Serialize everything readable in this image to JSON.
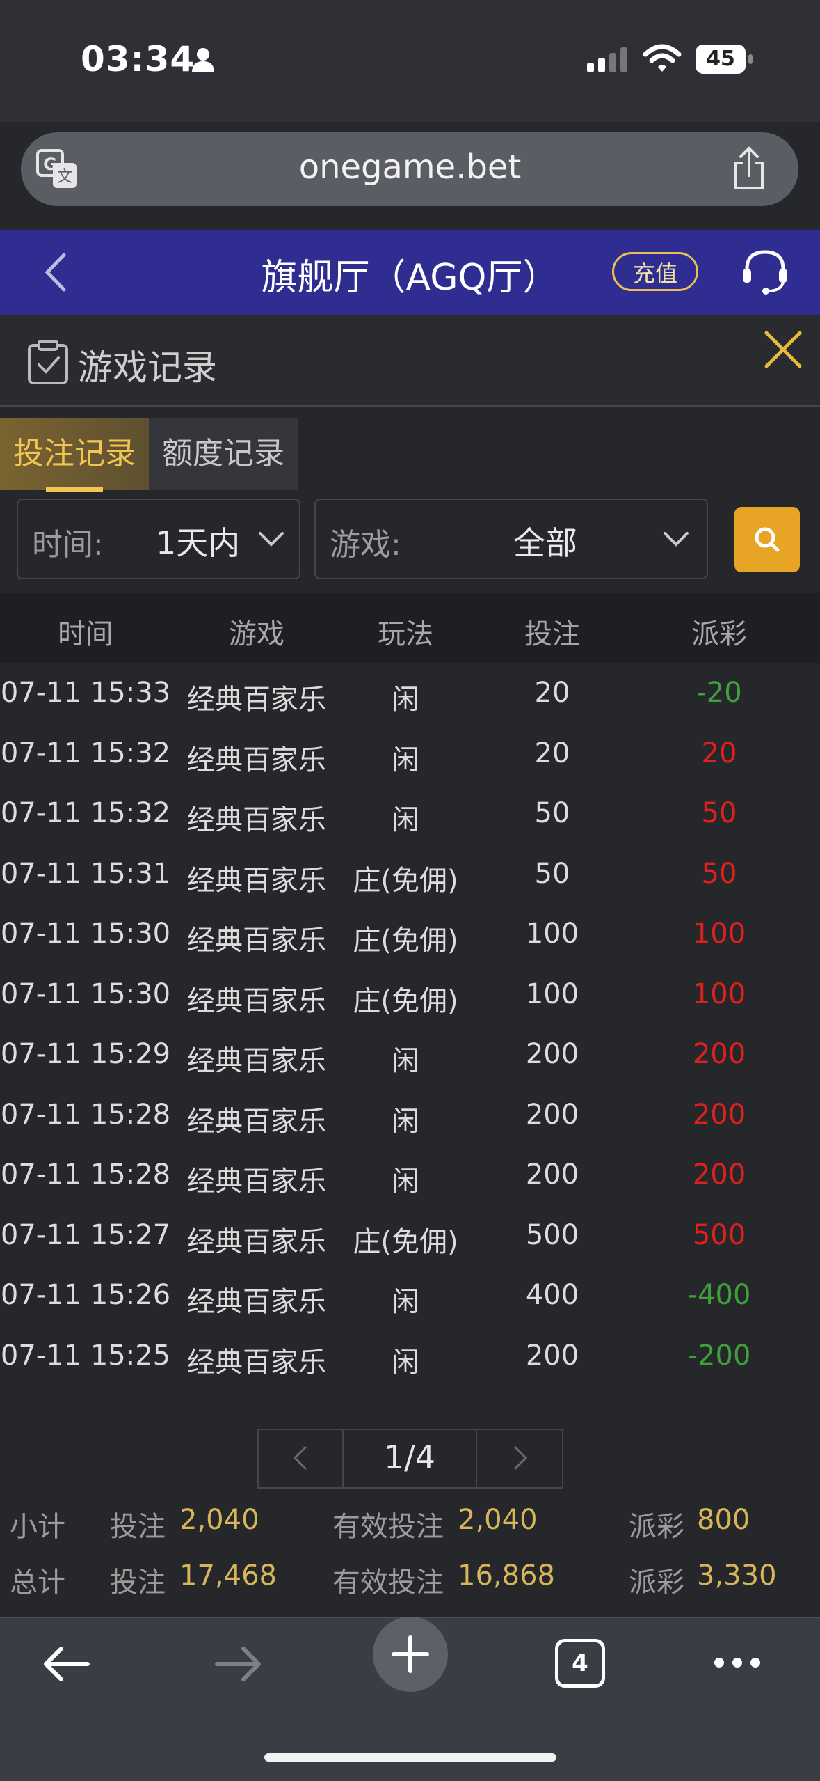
{
  "status": {
    "time": "03:34",
    "battery": "45"
  },
  "browser": {
    "url": "onegame.bet",
    "tab_count": "4"
  },
  "header": {
    "title": "旗舰厅（AGQ厅）",
    "recharge_label": "充值"
  },
  "section": {
    "title": "游戏记录"
  },
  "tabs": [
    {
      "label": "投注记录",
      "active": true
    },
    {
      "label": "额度记录",
      "active": false
    }
  ],
  "filters": {
    "time_label": "时间:",
    "time_value": "1天内",
    "game_label": "游戏:",
    "game_value": "全部"
  },
  "table": {
    "headers": [
      "时间",
      "游戏",
      "玩法",
      "投注",
      "派彩"
    ],
    "rows": [
      [
        "07-11 15:33",
        "经典百家乐",
        "闲",
        "20",
        "-20"
      ],
      [
        "07-11 15:32",
        "经典百家乐",
        "闲",
        "20",
        "20"
      ],
      [
        "07-11 15:32",
        "经典百家乐",
        "闲",
        "50",
        "50"
      ],
      [
        "07-11 15:31",
        "经典百家乐",
        "庄(免佣)",
        "50",
        "50"
      ],
      [
        "07-11 15:30",
        "经典百家乐",
        "庄(免佣)",
        "100",
        "100"
      ],
      [
        "07-11 15:30",
        "经典百家乐",
        "庄(免佣)",
        "100",
        "100"
      ],
      [
        "07-11 15:29",
        "经典百家乐",
        "闲",
        "200",
        "200"
      ],
      [
        "07-11 15:28",
        "经典百家乐",
        "闲",
        "200",
        "200"
      ],
      [
        "07-11 15:28",
        "经典百家乐",
        "闲",
        "200",
        "200"
      ],
      [
        "07-11 15:27",
        "经典百家乐",
        "庄(免佣)",
        "500",
        "500"
      ],
      [
        "07-11 15:26",
        "经典百家乐",
        "闲",
        "400",
        "-400"
      ],
      [
        "07-11 15:25",
        "经典百家乐",
        "闲",
        "200",
        "-200"
      ]
    ]
  },
  "pager": {
    "label": "1/4"
  },
  "summary": {
    "subtotal": {
      "label": "小计",
      "bet_label": "投注",
      "bet": "2,040",
      "valid_label": "有效投注",
      "valid": "2,040",
      "payout_label": "派彩",
      "payout": "800"
    },
    "total": {
      "label": "总计",
      "bet_label": "投注",
      "bet": "17,468",
      "valid_label": "有效投注",
      "valid": "16,868",
      "payout_label": "派彩",
      "payout": "3,330"
    }
  },
  "colors": {
    "header_bg": "#2f2d92",
    "accent_gold": "#e8a525",
    "negative": "#3fa03a",
    "positive": "#e0201c"
  },
  "icons": [
    "person-icon",
    "signal-icon",
    "wifi-icon",
    "translate-icon",
    "share-icon",
    "back-icon",
    "support-icon",
    "clipboard-check-icon",
    "close-icon",
    "chevron-down-icon",
    "search-icon",
    "arrow-left-icon",
    "arrow-right-icon",
    "plus-icon",
    "more-icon"
  ]
}
